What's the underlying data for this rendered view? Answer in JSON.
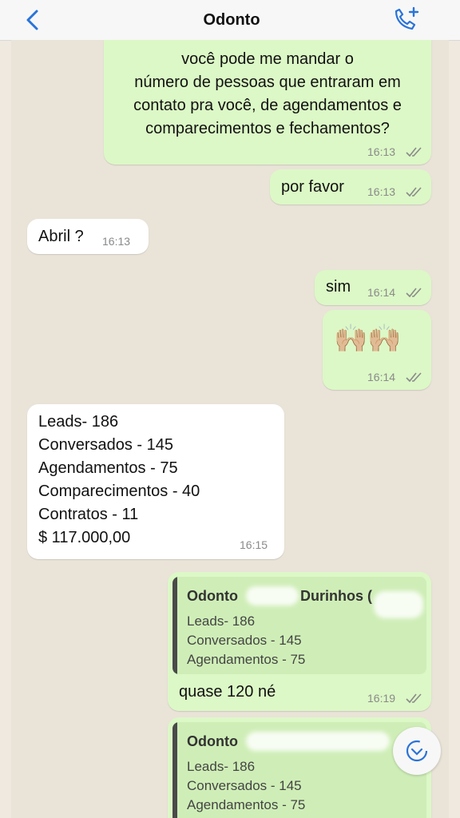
{
  "header": {
    "title": "Odonto",
    "back_icon": "chevron-left-icon",
    "call_icon": "add-call-icon",
    "accent": "#2a73d9"
  },
  "messages": {
    "m1": {
      "lines": [
        "você pode me mandar o",
        "número de pessoas que entraram em",
        "contato pra você, de agendamentos e",
        "comparecimentos e fechamentos?"
      ],
      "time": "16:13"
    },
    "m2": {
      "text": "por favor",
      "time": "16:13"
    },
    "m3": {
      "text": "Abril ?",
      "time": "16:13"
    },
    "m4": {
      "text": "sim",
      "time": "16:14"
    },
    "m5": {
      "emoji": "🙌🏼🙌🏼",
      "time": "16:14"
    },
    "m6": {
      "lines": [
        "Leads- 186",
        "Conversados - 145",
        "Agendamentos - 75",
        "Comparecimentos - 40",
        "Contratos - 11",
        "$ 117.000,00"
      ],
      "time": "16:15"
    },
    "m7": {
      "quote_title": "Odonto",
      "quote_title_tail": "Durinhos (",
      "quote_lines": [
        "Leads- 186",
        "Conversados - 145",
        "Agendamentos - 75"
      ],
      "text": "quase 120 né",
      "time": "16:19"
    },
    "m8": {
      "quote_title": "Odonto",
      "quote_lines": [
        "Leads- 186",
        "Conversados - 145",
        "Agendamentos - 75"
      ]
    }
  },
  "colors": {
    "outgoing": "#dcf8c6",
    "incoming": "#ffffff",
    "read_ticks": "#8a8a8a"
  }
}
